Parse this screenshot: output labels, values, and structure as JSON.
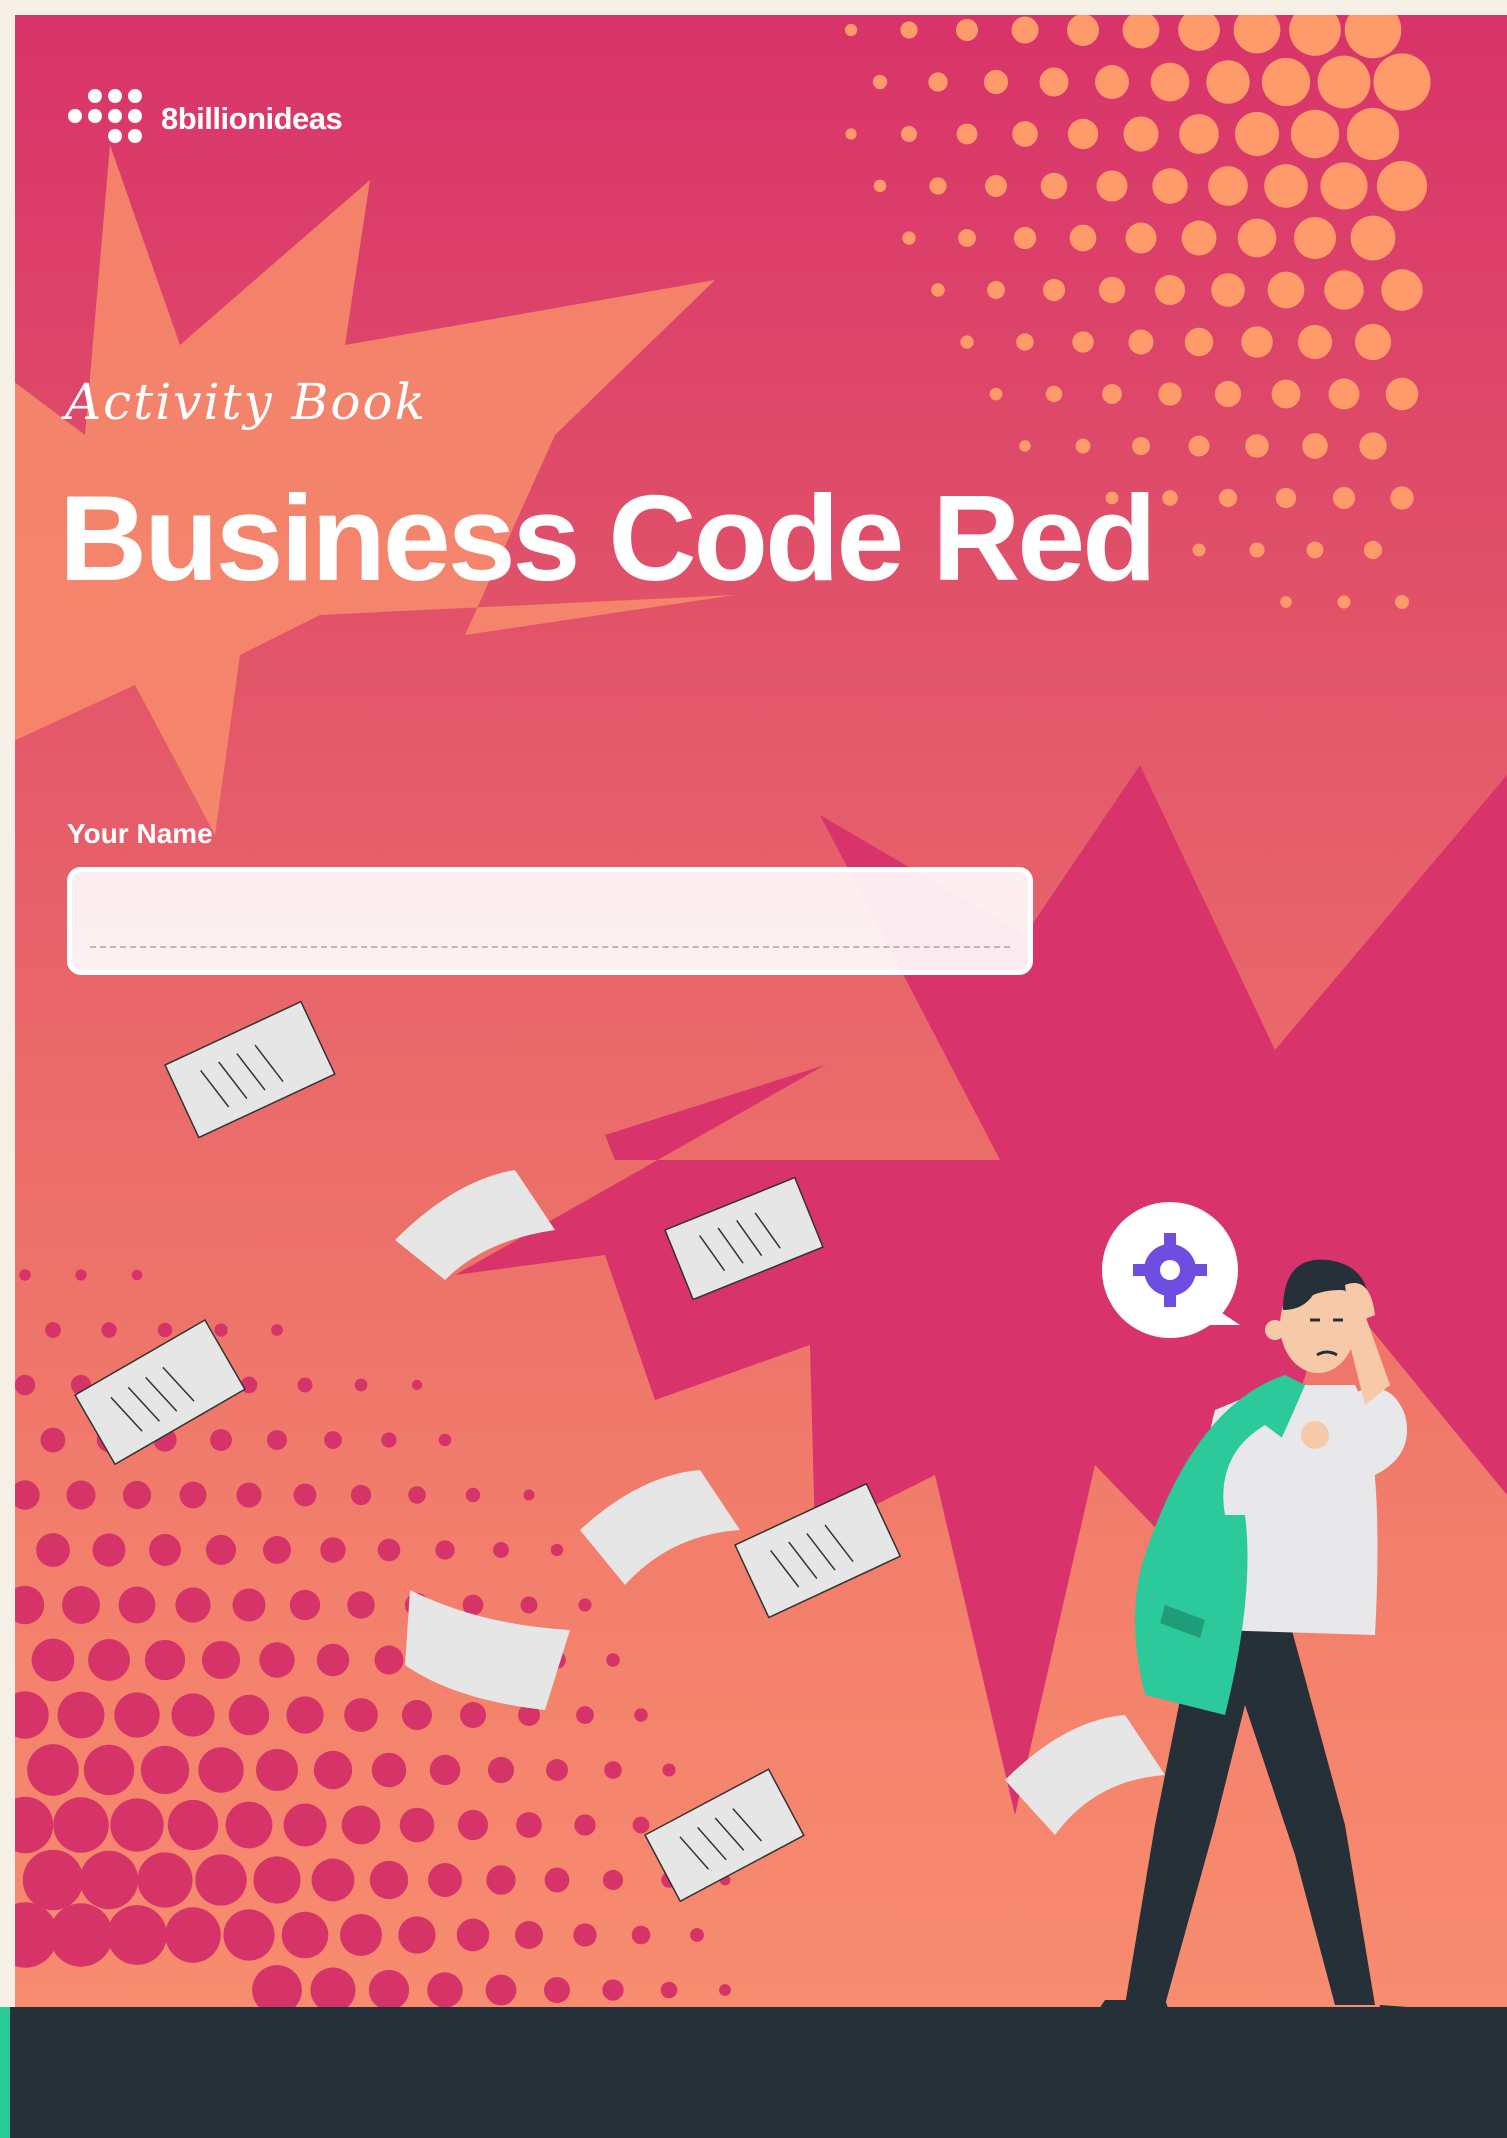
{
  "brand": {
    "logo_text": "8billionideas",
    "logo_icon": "dot-grid-icon"
  },
  "cover": {
    "subtitle": "Activity Book",
    "title": "Business Code Red"
  },
  "form": {
    "name_label": "Your Name",
    "name_value": "",
    "name_placeholder": ""
  },
  "illustration": {
    "description_icons": [
      "falling-papers-icon",
      "stressed-businessman-icon",
      "gear-speech-bubble-icon"
    ]
  },
  "colors": {
    "background_top": "#d8336a",
    "background_bottom": "#f99070",
    "burst_orange": "#f68a6c",
    "burst_pink": "#d63468",
    "dots_orange": "#ff9a6a",
    "dots_pink": "#d63468",
    "bottom_bar": "#263038",
    "accent_green": "#2cc99a",
    "text": "#ffffff"
  }
}
